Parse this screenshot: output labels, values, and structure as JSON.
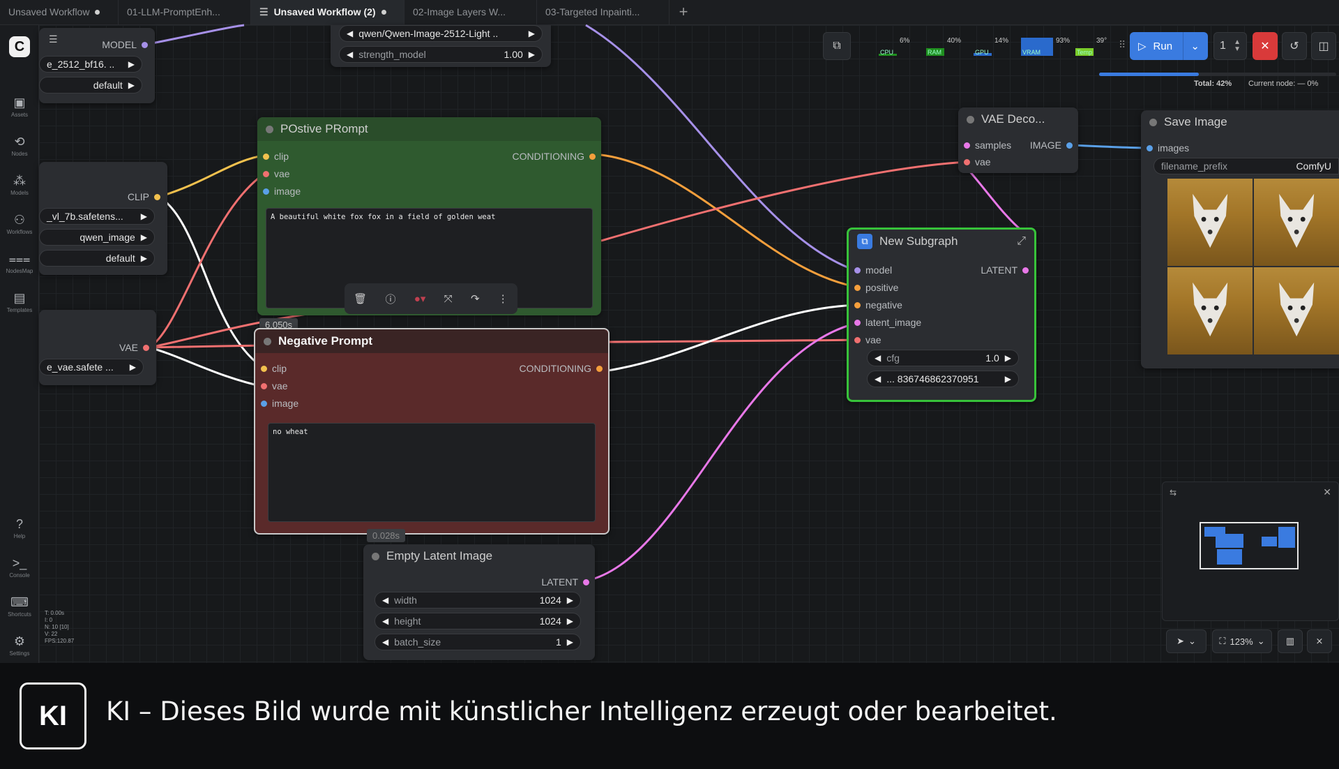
{
  "tabs": [
    {
      "label": "Unsaved Workflow",
      "dirty": true,
      "active": false
    },
    {
      "label": "01-LLM-PromptEnh...",
      "dirty": false,
      "active": false
    },
    {
      "label": "Unsaved Workflow (2)",
      "dirty": true,
      "active": true
    },
    {
      "label": "02-Image Layers W...",
      "dirty": false,
      "active": false
    },
    {
      "label": "03-Targeted Inpainti...",
      "dirty": false,
      "active": false
    }
  ],
  "new_tab_label": "+",
  "sidebar": {
    "logo": "C",
    "items": [
      {
        "label": "Assets",
        "icon": "assets-icon"
      },
      {
        "label": "Nodes",
        "icon": "nodes-icon"
      },
      {
        "label": "Models",
        "icon": "models-icon"
      },
      {
        "label": "Workflows",
        "icon": "workflows-icon"
      },
      {
        "label": "NodesMap",
        "icon": "nodesmap-icon"
      },
      {
        "label": "Templates",
        "icon": "templates-icon"
      },
      {
        "label": "Help",
        "icon": "help-icon"
      },
      {
        "label": "Console",
        "icon": "console-icon"
      },
      {
        "label": "Shortcuts",
        "icon": "shortcuts-icon"
      },
      {
        "label": "Settings",
        "icon": "settings-icon"
      }
    ]
  },
  "stats": [
    "T: 0.00s",
    "I: 0",
    "N: 10 [10]",
    "V: 22",
    "FPS:120.87"
  ],
  "nodes": {
    "model_loader": {
      "output": "MODEL",
      "w1": "e_2512_bf16. ..",
      "w2": "default"
    },
    "clip_loader": {
      "output": "CLIP",
      "w1": "_vl_7b.safetens...",
      "w2": "qwen_image",
      "w3": "default"
    },
    "vae_loader": {
      "output": "VAE",
      "w1": "e_vae.safete ..."
    },
    "lora": {
      "w1": "qwen/Qwen-Image-2512-Light ..",
      "w2_label": "strength_model",
      "w2_value": "1.00"
    },
    "positive": {
      "title": "POstive PRompt",
      "in1": "clip",
      "in2": "vae",
      "in3": "image",
      "out": "CONDITIONING",
      "text": "A beautiful white fox fox in a field of golden weat"
    },
    "positive_time": "6.050s",
    "negative": {
      "title": "Negative Prompt",
      "in1": "clip",
      "in2": "vae",
      "in3": "image",
      "out": "CONDITIONING",
      "text": "no wheat"
    },
    "negative_time": "0.028s",
    "latent": {
      "title": "Empty Latent Image",
      "out": "LATENT",
      "w1_label": "width",
      "w1_value": "1024",
      "w2_label": "height",
      "w2_value": "1024",
      "w3_label": "batch_size",
      "w3_value": "1"
    },
    "subgraph": {
      "title": "New Subgraph",
      "in1": "model",
      "in2": "positive",
      "in3": "negative",
      "in4": "latent_image",
      "in5": "vae",
      "out": "LATENT",
      "w1_label": "cfg",
      "w1_value": "1.0",
      "w2_value": "... 836746862370951"
    },
    "vae_decode": {
      "title": "VAE Deco...",
      "in1": "samples",
      "in2": "vae",
      "out": "IMAGE"
    },
    "save_image": {
      "title": "Save Image",
      "in1": "images",
      "w1_label": "filename_prefix",
      "w1_value": "ComfyU"
    }
  },
  "toolbar": {
    "meters": [
      {
        "label": "CPU",
        "value": "6%",
        "level": 0.06
      },
      {
        "label": "RAM",
        "value": "40%",
        "level": 0.4
      },
      {
        "label": "GPU",
        "value": "14%",
        "level": 0.14
      },
      {
        "label": "VRAM",
        "value": "93%",
        "level": 0.93
      },
      {
        "label": "Temp",
        "value": "39°",
        "level": 0.39
      }
    ],
    "run_label": "Run",
    "batch_count": "1",
    "progress": 0.42,
    "total_label": "Total: 42%",
    "current_label": "Current node: — 0%"
  },
  "bottom_tools": {
    "zoom": "123%"
  },
  "banner": {
    "badge": "KI",
    "text": "KI – Dieses Bild wurde mit künstlicher Intelligenz erzeugt oder bearbeitet."
  },
  "colors": {
    "accent": "#3a7be0",
    "positive_node": "#2f5a2f",
    "negative_node": "#5a2a2a",
    "subgraph_border": "#37c23a"
  }
}
